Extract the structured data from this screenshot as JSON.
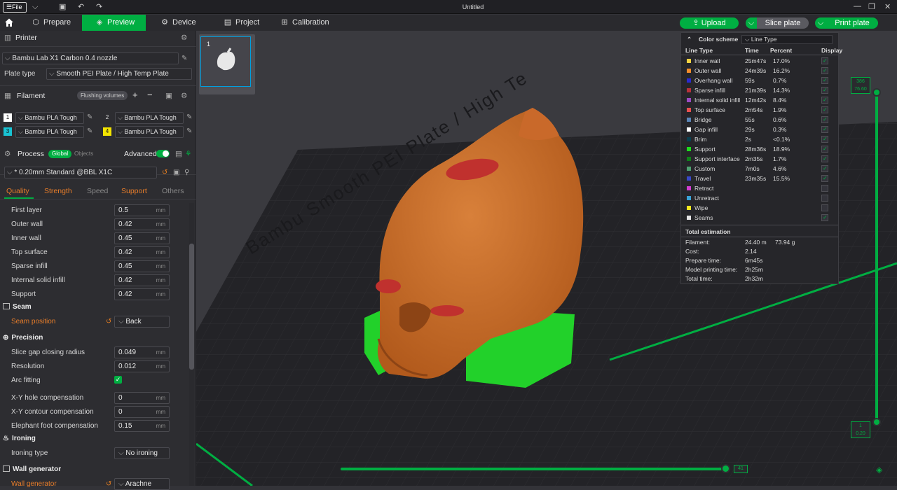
{
  "titlebar": {
    "file_label": "File",
    "title": "Untitled"
  },
  "tabs": {
    "prepare": "Prepare",
    "preview": "Preview",
    "device": "Device",
    "project": "Project",
    "calibration": "Calibration"
  },
  "actions": {
    "upload": "Upload",
    "slice": "Slice plate",
    "print": "Print plate"
  },
  "printer": {
    "header": "Printer",
    "name": "Bambu Lab X1 Carbon 0.4 nozzle",
    "plate_type_label": "Plate type",
    "plate_type": "Smooth PEI Plate / High Temp Plate"
  },
  "filament": {
    "header": "Filament",
    "flushing": "Flushing volumes",
    "slots": [
      {
        "n": "1",
        "name": "Bambu PLA Tough",
        "color": "#ffffff"
      },
      {
        "n": "2",
        "name": "Bambu PLA Tough",
        "color": "#2d2d31"
      },
      {
        "n": "3",
        "name": "Bambu PLA Tough",
        "color": "#19c3d3"
      },
      {
        "n": "4",
        "name": "Bambu PLA Tough",
        "color": "#f3e500"
      }
    ]
  },
  "process": {
    "header": "Process",
    "global": "Global",
    "objects": "Objects",
    "advanced": "Advanced",
    "preset": "* 0.20mm Standard @BBL X1C",
    "tabs": [
      "Quality",
      "Strength",
      "Speed",
      "Support",
      "Others"
    ]
  },
  "quality": {
    "layer": [
      {
        "label": "First layer",
        "value": "0.5",
        "unit": "mm"
      },
      {
        "label": "Outer wall",
        "value": "0.42",
        "unit": "mm"
      },
      {
        "label": "Inner wall",
        "value": "0.45",
        "unit": "mm"
      },
      {
        "label": "Top surface",
        "value": "0.42",
        "unit": "mm"
      },
      {
        "label": "Sparse infill",
        "value": "0.45",
        "unit": "mm"
      },
      {
        "label": "Internal solid infill",
        "value": "0.42",
        "unit": "mm"
      },
      {
        "label": "Support",
        "value": "0.42",
        "unit": "mm"
      }
    ],
    "seam_header": "Seam",
    "seam_label": "Seam position",
    "seam_value": "Back",
    "precision_header": "Precision",
    "precision": [
      {
        "label": "Slice gap closing radius",
        "value": "0.049",
        "unit": "mm"
      },
      {
        "label": "Resolution",
        "value": "0.012",
        "unit": "mm"
      }
    ],
    "arc_label": "Arc fitting",
    "precision2": [
      {
        "label": "X-Y hole compensation",
        "value": "0",
        "unit": "mm"
      },
      {
        "label": "X-Y contour compensation",
        "value": "0",
        "unit": "mm"
      },
      {
        "label": "Elephant foot compensation",
        "value": "0.15",
        "unit": "mm"
      }
    ],
    "ironing_header": "Ironing",
    "ironing_label": "Ironing type",
    "ironing_value": "No ironing",
    "wallgen_header": "Wall generator",
    "wallgen_label": "Wall generator",
    "wallgen_value": "Arachne"
  },
  "plate": {
    "thumb_number": "1"
  },
  "bed_text": "Bambu Smooth PEI Plate / High Te",
  "vslider": {
    "top_layer": "386",
    "top_height": "76.60",
    "bottom_layer": "1",
    "bottom_height": "0.20"
  },
  "hslider": {
    "value": "41"
  },
  "color_scheme": {
    "label": "Color scheme",
    "value": "Line Type",
    "headers": [
      "Line Type",
      "Time",
      "Percent",
      "Display"
    ],
    "rows": [
      {
        "name": "Inner wall",
        "time": "25m47s",
        "pct": "17.0%",
        "color": "#f5d242",
        "on": true
      },
      {
        "name": "Outer wall",
        "time": "24m39s",
        "pct": "16.2%",
        "color": "#f58d2a",
        "on": true
      },
      {
        "name": "Overhang wall",
        "time": "59s",
        "pct": "0.7%",
        "color": "#2a2ad0",
        "on": true
      },
      {
        "name": "Sparse infill",
        "time": "21m39s",
        "pct": "14.3%",
        "color": "#b8313a",
        "on": true
      },
      {
        "name": "Internal solid infill",
        "time": "12m42s",
        "pct": "8.4%",
        "color": "#9b4bc4",
        "on": true
      },
      {
        "name": "Top surface",
        "time": "2m54s",
        "pct": "1.9%",
        "color": "#e85050",
        "on": true
      },
      {
        "name": "Bridge",
        "time": "55s",
        "pct": "0.6%",
        "color": "#5a86b8",
        "on": true
      },
      {
        "name": "Gap infill",
        "time": "29s",
        "pct": "0.3%",
        "color": "#ffffff",
        "on": true
      },
      {
        "name": "Brim",
        "time": "2s",
        "pct": "<0.1%",
        "color": "#0a4050",
        "on": true
      },
      {
        "name": "Support",
        "time": "28m36s",
        "pct": "18.9%",
        "color": "#1edc1e",
        "on": true
      },
      {
        "name": "Support interface",
        "time": "2m35s",
        "pct": "1.7%",
        "color": "#10801a",
        "on": true
      },
      {
        "name": "Custom",
        "time": "7m0s",
        "pct": "4.6%",
        "color": "#4fa070",
        "on": true
      },
      {
        "name": "Travel",
        "time": "23m35s",
        "pct": "15.5%",
        "color": "#3848c8",
        "on": true
      },
      {
        "name": "Retract",
        "time": "",
        "pct": "",
        "color": "#d23ed2",
        "on": false
      },
      {
        "name": "Unretract",
        "time": "",
        "pct": "",
        "color": "#3aa4d8",
        "on": false
      },
      {
        "name": "Wipe",
        "time": "",
        "pct": "",
        "color": "#f8e820",
        "on": false
      },
      {
        "name": "Seams",
        "time": "",
        "pct": "",
        "color": "#e6e6e6",
        "on": true
      }
    ]
  },
  "estimation": {
    "header": "Total estimation",
    "filament_label": "Filament:",
    "filament_len": "24.40 m",
    "filament_wt": "73.94 g",
    "cost_label": "Cost:",
    "cost": "2.14",
    "prepare_label": "Prepare time:",
    "prepare": "6m45s",
    "model_label": "Model printing time:",
    "model": "2h25m",
    "total_label": "Total time:",
    "total": "2h32m"
  }
}
